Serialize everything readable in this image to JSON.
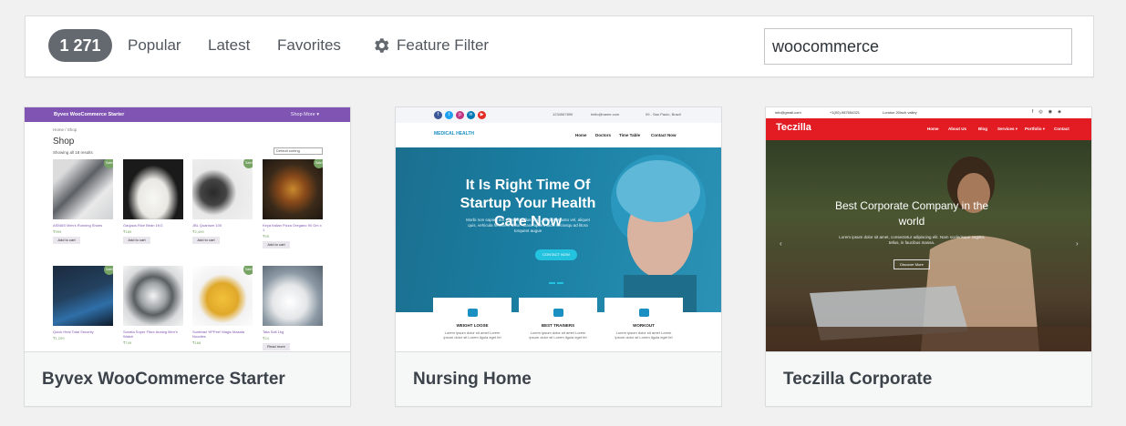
{
  "toolbar": {
    "count": "1 271",
    "tabs": [
      "Popular",
      "Latest",
      "Favorites"
    ],
    "feature_filter": "Feature Filter",
    "search_value": "woocommerce"
  },
  "themes": [
    {
      "name": "Byvex WooCommerce Starter",
      "screenshot": {
        "site_title": "Byvex WooCommerce Starter",
        "nav": "Shop  More ▾",
        "breadcrumb": "Home / Shop",
        "heading": "Shop",
        "showing": "Showing all 18 results",
        "sort": "Default sorting",
        "products": [
          {
            "name": "ASMAS Men's Running Shoes",
            "price": "₹999",
            "button": "Add to cart",
            "sale": "Sale!"
          },
          {
            "name": "Gaujaus Rice Bean 1KG",
            "price": "₹189",
            "button": "Add to cart",
            "sale": ""
          },
          {
            "name": "JBL Quantum 100",
            "price": "₹2,499",
            "button": "Add to cart",
            "sale": "Sale!"
          },
          {
            "name": "Keya Italian Pizza Oregano 90 Gm x 1",
            "price": "₹99",
            "button": "Add to cart",
            "sale": "Sale!"
          },
          {
            "name": "Quick Heal Total Security",
            "price": "₹1,299",
            "button": "Add to cart",
            "sale": "Sale!"
          },
          {
            "name": "Sonata Super Fibre Analog Men's Watch",
            "price": "₹749",
            "button": "Add to cart",
            "sale": ""
          },
          {
            "name": "Sunfeast YiPPee! Magic Masala Noodles",
            "price": "₹168",
            "button": "Add to cart",
            "sale": "Sale!"
          },
          {
            "name": "Tata Salt 1kg",
            "price": "₹24",
            "button": "Read more",
            "sale": ""
          }
        ]
      }
    },
    {
      "name": "Nursing Home",
      "screenshot": {
        "social": [
          "f",
          "t",
          "p",
          "in",
          "▶"
        ],
        "phone": "1234567890",
        "email": "hello@name.com",
        "address": "09 - Sao Paulo, Brazil",
        "logo": "MEDICAL HEALTH",
        "nav": [
          "Home",
          "Doctors",
          "Time Table",
          "Contact Now"
        ],
        "headline": "It Is Right Time Of Startup Your Health Care Now",
        "paragraph": "Morbi non sapien dui. Aenean tellus urna, blandit ut justo vel, aliquet quis, vehicula hendrerit dolor. Class aptent taciti sociosqu ad litora torquent augue",
        "button": "CONTACT NOW",
        "features": [
          {
            "title": "WEIGHT LOOSE",
            "desc": "Lorem ipsum dolor sit amet Lorem ipsum dolor sit Lorem ligula eget fel"
          },
          {
            "title": "BEST TRAINERS",
            "desc": "Lorem ipsum dolor sit amet Lorem ipsum dolor sit Lorem ligula eget fel"
          },
          {
            "title": "WORKOUT",
            "desc": "Lorem ipsum dolor sit amet Lorem ipsum dolor sit Lorem ligula eget fel"
          }
        ]
      }
    },
    {
      "name": "Teczilla Corporate",
      "screenshot": {
        "email": "info@gmail.com",
        "phone": "+1(00)-987654321",
        "address": "London 20inch valley",
        "logo": "Teczilla",
        "nav": [
          "Home",
          "About Us",
          "Blog",
          "Services ▾",
          "Portfolio ▾",
          "Contact"
        ],
        "headline": "Best Corporate Company in the world",
        "paragraph": "Lorem ipsum dolor sit amet, consectetur adipiscing elit. Nam scelerisque sagittis tellus, in faucibus massa.",
        "button": "Discover More"
      }
    }
  ]
}
